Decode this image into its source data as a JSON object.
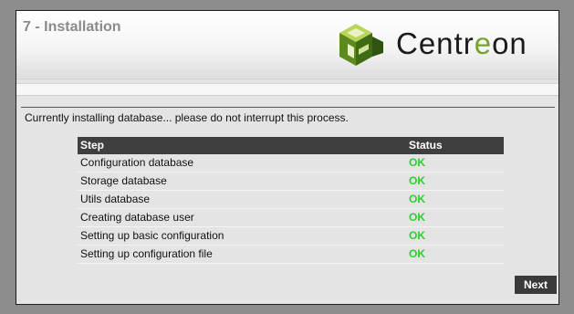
{
  "header": {
    "title": "7 - Installation",
    "logo": {
      "text_before": "Centr",
      "text_accent": "e",
      "text_after": "on",
      "icon": "centreon-cube-icon",
      "accent_color": "#74a42a"
    }
  },
  "main": {
    "message": "Currently installing database... please do not interrupt this process.",
    "table": {
      "headers": {
        "step": "Step",
        "status": "Status"
      },
      "rows": [
        {
          "step": "Configuration database",
          "status": "OK"
        },
        {
          "step": "Storage database",
          "status": "OK"
        },
        {
          "step": "Utils database",
          "status": "OK"
        },
        {
          "step": "Creating database user",
          "status": "OK"
        },
        {
          "step": "Setting up basic configuration",
          "status": "OK"
        },
        {
          "step": "Setting up configuration file",
          "status": "OK"
        }
      ],
      "status_color": "#2ad12a"
    }
  },
  "footer": {
    "next_label": "Next"
  }
}
